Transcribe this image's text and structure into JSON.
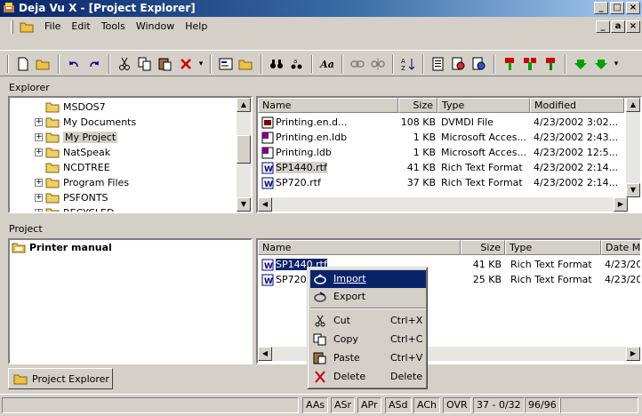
{
  "window": {
    "title": "Deja Vu X - [Project Explorer]",
    "buttons": [
      "_",
      "□",
      "×"
    ]
  },
  "mdi_buttons": [
    "_",
    "a",
    "×"
  ],
  "menu": [
    {
      "label": "File"
    },
    {
      "label": "Edit"
    },
    {
      "label": "Tools"
    },
    {
      "label": "Window"
    },
    {
      "label": "Help"
    }
  ],
  "toolbar": {
    "icons": [
      "new-icon",
      "open-icon",
      "undo-icon",
      "redo-icon",
      "cut-icon",
      "copy-icon",
      "paste-icon",
      "delete-icon",
      "dropdown-icon",
      "properties-icon",
      "open-folder-icon",
      "find-icon",
      "find-next-icon",
      "font-icon",
      "link-icon",
      "unlink-icon",
      "sort-icon",
      "import-icon",
      "preview-icon",
      "preview-alt-icon",
      "tag-icon",
      "tag-pair-icon",
      "tag-alt-icon",
      "arrow-down-green-icon",
      "arrow-down-green-2-icon"
    ],
    "colors": {
      "accent": "#0a246a",
      "red": "#cc0000",
      "green": "#00a000"
    }
  },
  "explorer": {
    "label": "Explorer",
    "tree": [
      {
        "label": "MSDOS7",
        "expander": ""
      },
      {
        "label": "My Documents",
        "expander": "+"
      },
      {
        "label": "My Project",
        "expander": "+",
        "selected": true
      },
      {
        "label": "NatSpeak",
        "expander": "+"
      },
      {
        "label": "NCDTREE",
        "expander": ""
      },
      {
        "label": "Program Files",
        "expander": "+"
      },
      {
        "label": "PSFONTS",
        "expander": "+"
      },
      {
        "label": "RECYCLED",
        "expander": "+"
      }
    ],
    "columns": [
      "Name",
      "Size",
      "Type",
      "Modified"
    ],
    "files": [
      {
        "name": "Printing.en.d...",
        "size": "108 KB",
        "type": "DVMDI File",
        "modified": "4/23/2002 3:02...",
        "icon": "dvmdi-file-icon"
      },
      {
        "name": "Printing.en.ldb",
        "size": "1 KB",
        "type": "Microsoft Acces...",
        "modified": "4/23/2002 2:43...",
        "icon": "access-file-icon"
      },
      {
        "name": "Printing.ldb",
        "size": "1 KB",
        "type": "Microsoft Acces...",
        "modified": "4/23/2002 12:5...",
        "icon": "access-file-icon"
      },
      {
        "name": "SP1440.rtf",
        "size": "41 KB",
        "type": "Rich Text Format",
        "modified": "4/23/2002 2:14...",
        "icon": "word-file-icon"
      },
      {
        "name": "SP720.rtf",
        "size": "37 KB",
        "type": "Rich Text Format",
        "modified": "4/23/2002 2:14...",
        "icon": "word-file-icon"
      }
    ]
  },
  "project": {
    "label": "Project",
    "tree_root": "Printer manual",
    "columns": [
      "Name",
      "Size",
      "Type",
      "Date M"
    ],
    "files": [
      {
        "name": "SP1440.rtf",
        "size": "41 KB",
        "type": "Rich Text Format",
        "date": "4/23/20"
      },
      {
        "name": "SP720.rtf",
        "size": "25 KB",
        "type": "Rich Text Format",
        "date": "4/23/20"
      }
    ]
  },
  "context_menu": {
    "items": [
      {
        "label": "Import",
        "shortcut": "",
        "icon": "import-icon",
        "highlighted": true
      },
      {
        "label": "Export",
        "shortcut": "",
        "icon": "export-icon"
      },
      {
        "label": "Cut",
        "shortcut": "Ctrl+X",
        "icon": "cut-icon"
      },
      {
        "label": "Copy",
        "shortcut": "Ctrl+C",
        "icon": "copy-icon"
      },
      {
        "label": "Paste",
        "shortcut": "Ctrl+V",
        "icon": "paste-icon"
      },
      {
        "label": "Delete",
        "shortcut": "Delete",
        "icon": "delete-icon"
      }
    ]
  },
  "tabs": [
    {
      "label": "Project Explorer"
    }
  ],
  "status": [
    "AAs",
    "ASr",
    "APr",
    "ASd",
    "ACh",
    "OVR",
    "37 - 0/32",
    "96/96"
  ]
}
